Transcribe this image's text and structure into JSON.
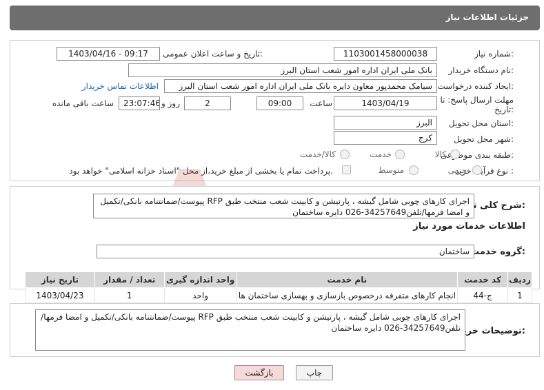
{
  "header": {
    "title": "جزئیات اطلاعات نیاز"
  },
  "form": {
    "need_number_label": "شماره نیاز:",
    "need_number": "1103001458000038",
    "announce_label": "تاریخ و ساعت اعلان عمومی:",
    "announce_value": "1403/04/16 - 09:17",
    "buyer_org_label": "نام دستگاه خریدار:",
    "buyer_org": "بانک ملی ایران اداره امور شعب استان البرز",
    "creator_label": "ایجاد کننده درخواست:",
    "creator": "سیامک محمدپور معاون دایره  بانک ملی ایران اداره امور شعب استان البرز",
    "contact_link": "اطلاعات تماس خریدار",
    "deadline_label_1": "مهلت ارسال پاسخ: تا",
    "deadline_label_2": "تاریخ:",
    "deadline_date": "1403/04/19",
    "time_label": "ساعت",
    "deadline_time": "09:00",
    "days_value": "2",
    "days_label": "روز و",
    "remaining_time": "23:07:46",
    "remaining_label": "ساعت باقی مانده",
    "province_label": "استان محل تحویل:",
    "province": "البرز",
    "city_label": "شهر محل تحویل:",
    "city": "کرج",
    "category_label": "طبقه بندی موضوعی:",
    "category_options": [
      "کالا",
      "خدمت",
      "کالا/خدمت"
    ],
    "process_label": "نوع فرآیند خرید :",
    "process_options": [
      "جزیی",
      "متوسط"
    ],
    "payment_note": "پرداخت تمام یا بخشی از مبلغ خرید،از محل \"اسناد خزانه اسلامی\" خواهد بود."
  },
  "summary": {
    "label": "شرح کلی نیاز:",
    "text": "اجرای کارهای چوبی شامل گیشه ، پارتیشن و کابینت شعب منتخب طبق RFP پیوست/ضمانتنامه بانکی/تکمیل و امضا فرمها/تلفن34257649-026 دایره ساختمان"
  },
  "services": {
    "section_title": "اطلاعات خدمات مورد نیاز",
    "group_label": "گروه خدمت:",
    "group_value": "ساختمان",
    "columns": [
      "ردیف",
      "کد خدمت",
      "نام خدمت",
      "واحد اندازه گیری",
      "تعداد / مقدار",
      "تاریخ نیاز"
    ],
    "rows": [
      [
        "1",
        "ج-44",
        "انجام کارهای متفرقه درخصوص بازسازی و بهسازی ساختمان ها",
        "واحد",
        "1",
        "1403/04/23"
      ]
    ]
  },
  "buyer_notes": {
    "label": "توضیحات خریدار:",
    "text": "اجرای کارهای چوبی شامل گیشه ، پارتیشن و کابینت شعب منتخب طبق RFP پیوست/ضمانتنامه بانکی/تکمیل و امضا فرمها/تلفن34257649-026 دایره ساختمان"
  },
  "buttons": {
    "print": "چاپ",
    "back": "بازگشت"
  },
  "watermark": {
    "text": "AriaTender.net"
  }
}
